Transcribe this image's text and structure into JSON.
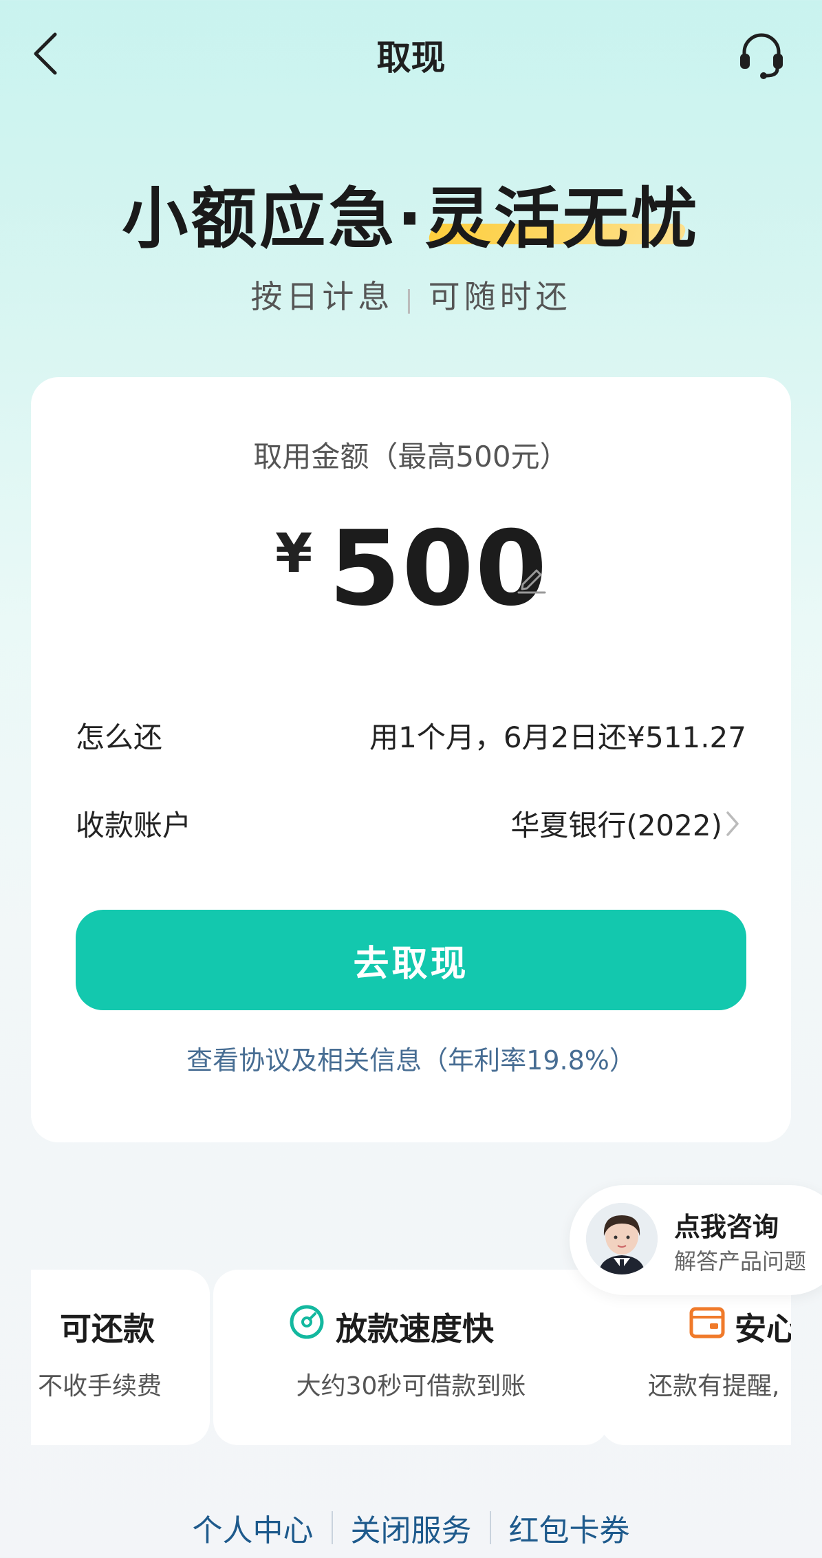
{
  "header": {
    "title": "取现",
    "back_icon": "chevron-left-icon",
    "service_icon": "headset-icon"
  },
  "hero": {
    "slogan": "小额应急·灵活无忧",
    "sub_left": "按日计息",
    "sub_right": "可随时还"
  },
  "withdraw": {
    "amount_label": "取用金额（最高500元）",
    "currency": "¥",
    "amount": "500",
    "repay_label": "怎么还",
    "repay_value": "用1个月，6月2日还¥511.27",
    "account_label": "收款账户",
    "account_value": "华夏银行(2022)",
    "button_label": "去取现",
    "agreement_text": "查看协议及相关信息（年利率19.8%）"
  },
  "consult": {
    "title": "点我咨询",
    "subtitle": "解答产品问题"
  },
  "features": [
    {
      "title": "可还款",
      "subtitle": "不收手续费"
    },
    {
      "title": "放款速度快",
      "subtitle": "大约30秒可借款到账",
      "icon": "speed-gauge-icon"
    },
    {
      "title": "安心",
      "subtitle": "还款有提醒,",
      "icon": "wallet-icon"
    }
  ],
  "footer": {
    "links": [
      "个人中心",
      "关闭服务",
      "红包卡券"
    ]
  },
  "colors": {
    "accent": "#13c8ae",
    "link": "#476d93",
    "highlight": "#ffcc33"
  }
}
